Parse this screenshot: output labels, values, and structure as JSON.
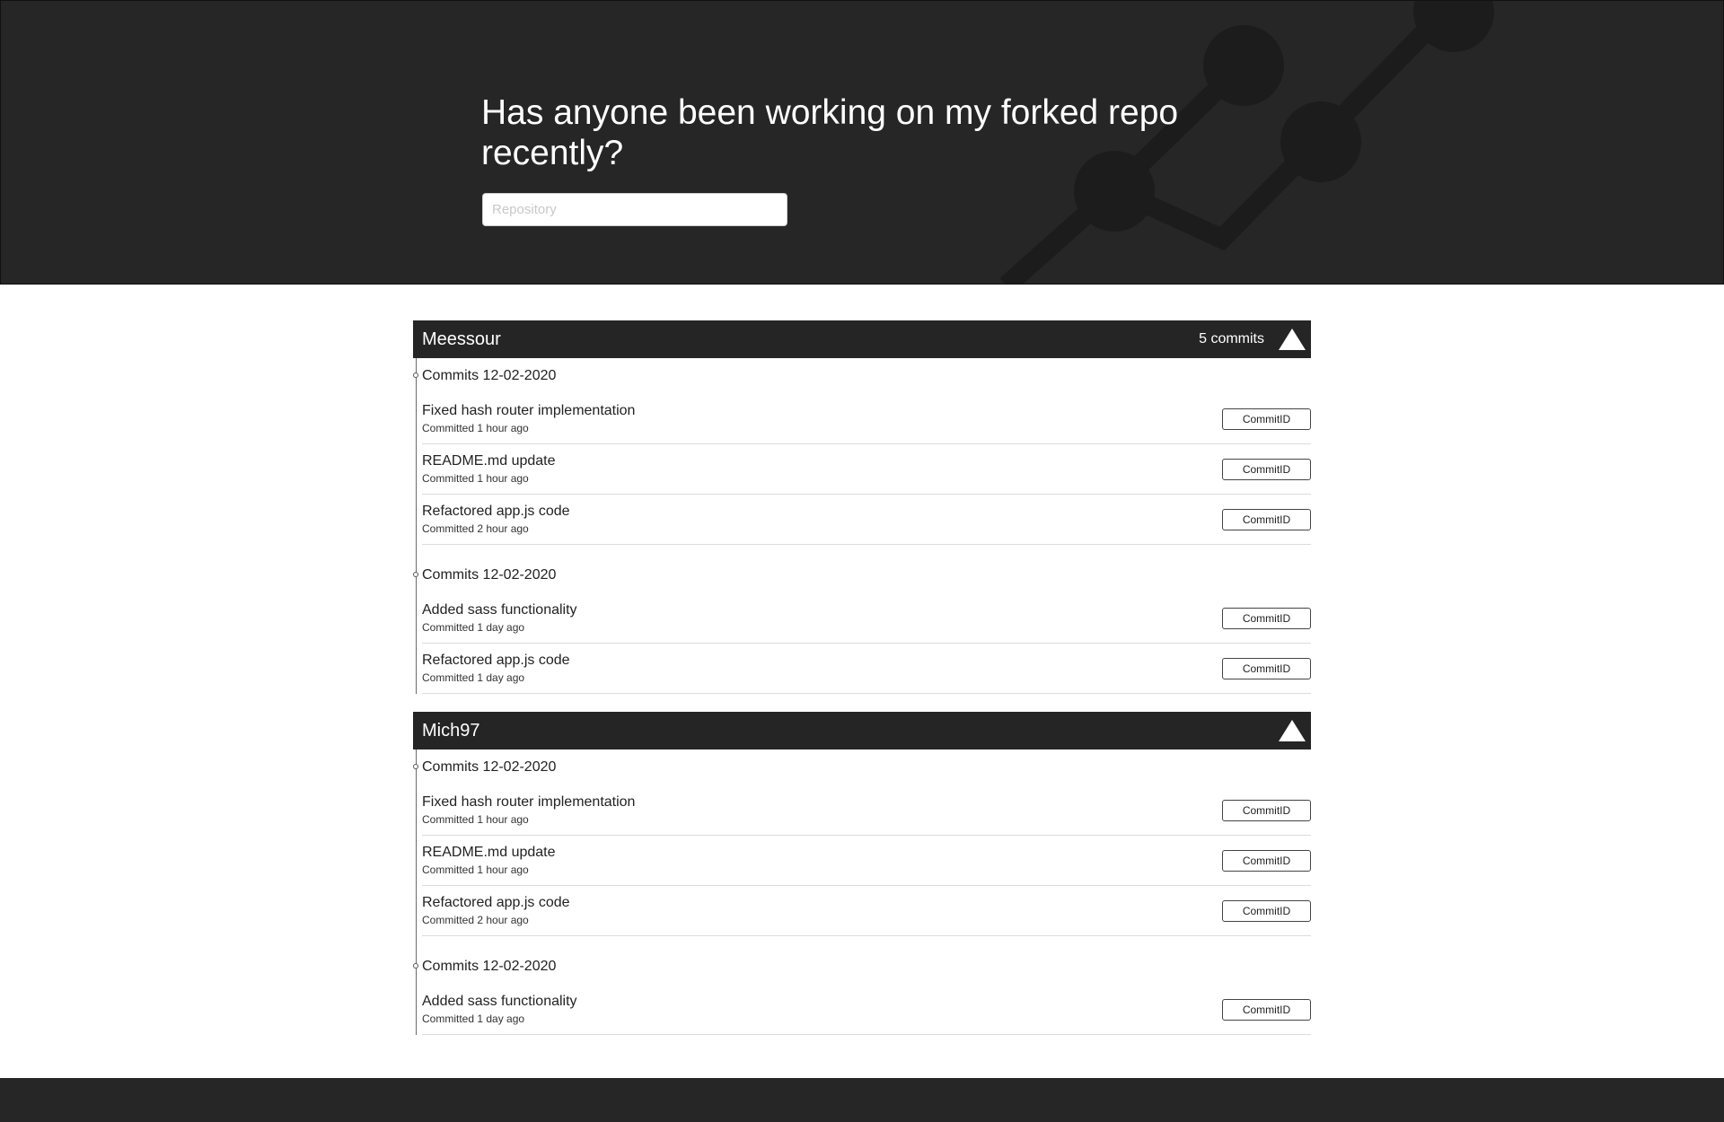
{
  "hero": {
    "title": "Has anyone been working on my forked repo recently?",
    "repo_placeholder": "Repository",
    "repo_value": ""
  },
  "contributors": [
    {
      "name": "Meessour",
      "commit_count": "5 commits",
      "groups": [
        {
          "label": "Commits 12-02-2020",
          "commits": [
            {
              "message": "Fixed hash router implementation",
              "time": "Committed 1 hour ago",
              "button": "CommitID"
            },
            {
              "message": "README.md update",
              "time": "Committed 1 hour ago",
              "button": "CommitID"
            },
            {
              "message": "Refactored app.js code",
              "time": "Committed 2 hour ago",
              "button": "CommitID"
            }
          ]
        },
        {
          "label": "Commits 12-02-2020",
          "commits": [
            {
              "message": "Added sass functionality",
              "time": "Committed 1 day ago",
              "button": "CommitID"
            },
            {
              "message": "Refactored app.js code",
              "time": "Committed 1 day ago",
              "button": "CommitID"
            }
          ]
        }
      ]
    },
    {
      "name": "Mich97",
      "commit_count": "",
      "groups": [
        {
          "label": "Commits 12-02-2020",
          "commits": [
            {
              "message": "Fixed hash router implementation",
              "time": "Committed 1 hour ago",
              "button": "CommitID"
            },
            {
              "message": "README.md update",
              "time": "Committed 1 hour ago",
              "button": "CommitID"
            },
            {
              "message": "Refactored app.js code",
              "time": "Committed 2 hour ago",
              "button": "CommitID"
            }
          ]
        },
        {
          "label": "Commits 12-02-2020",
          "commits": [
            {
              "message": "Added sass functionality",
              "time": "Committed 1 day ago",
              "button": "CommitID"
            }
          ]
        }
      ]
    }
  ],
  "icons": {
    "collapse": "triangle-up-icon",
    "hero_decoration": "git-graph-icon"
  },
  "colors": {
    "hero_bg": "#262626",
    "header_bg": "#252525",
    "graph": "#1c1c1c"
  }
}
